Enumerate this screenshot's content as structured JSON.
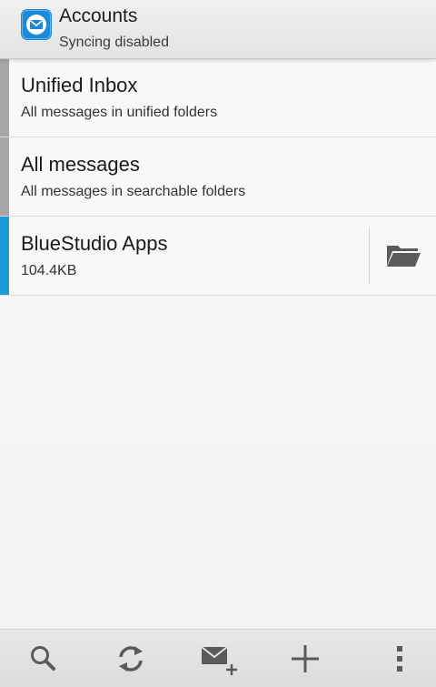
{
  "header": {
    "title": "Accounts",
    "subtitle": "Syncing disabled",
    "app_icon": "mail-envelope-icon"
  },
  "accounts": [
    {
      "title": "Unified Inbox",
      "subtitle": "All messages in unified folders",
      "stripe_color": "#a6a6a6"
    },
    {
      "title": "All messages",
      "subtitle": "All messages in searchable folders",
      "stripe_color": "#a6a6a6"
    },
    {
      "title": "BlueStudio Apps",
      "subtitle": "104.4KB",
      "stripe_color": "#1e9ad8",
      "action_icon": "folder-icon"
    }
  ],
  "toolbar": {
    "icons": [
      "search-icon",
      "refresh-icon",
      "compose-icon",
      "add-icon",
      "overflow-menu-icon"
    ]
  },
  "colors": {
    "accent": "#1e9ad8",
    "neutral_stripe": "#a6a6a6",
    "toolbar_icon": "#5a5a5a"
  }
}
